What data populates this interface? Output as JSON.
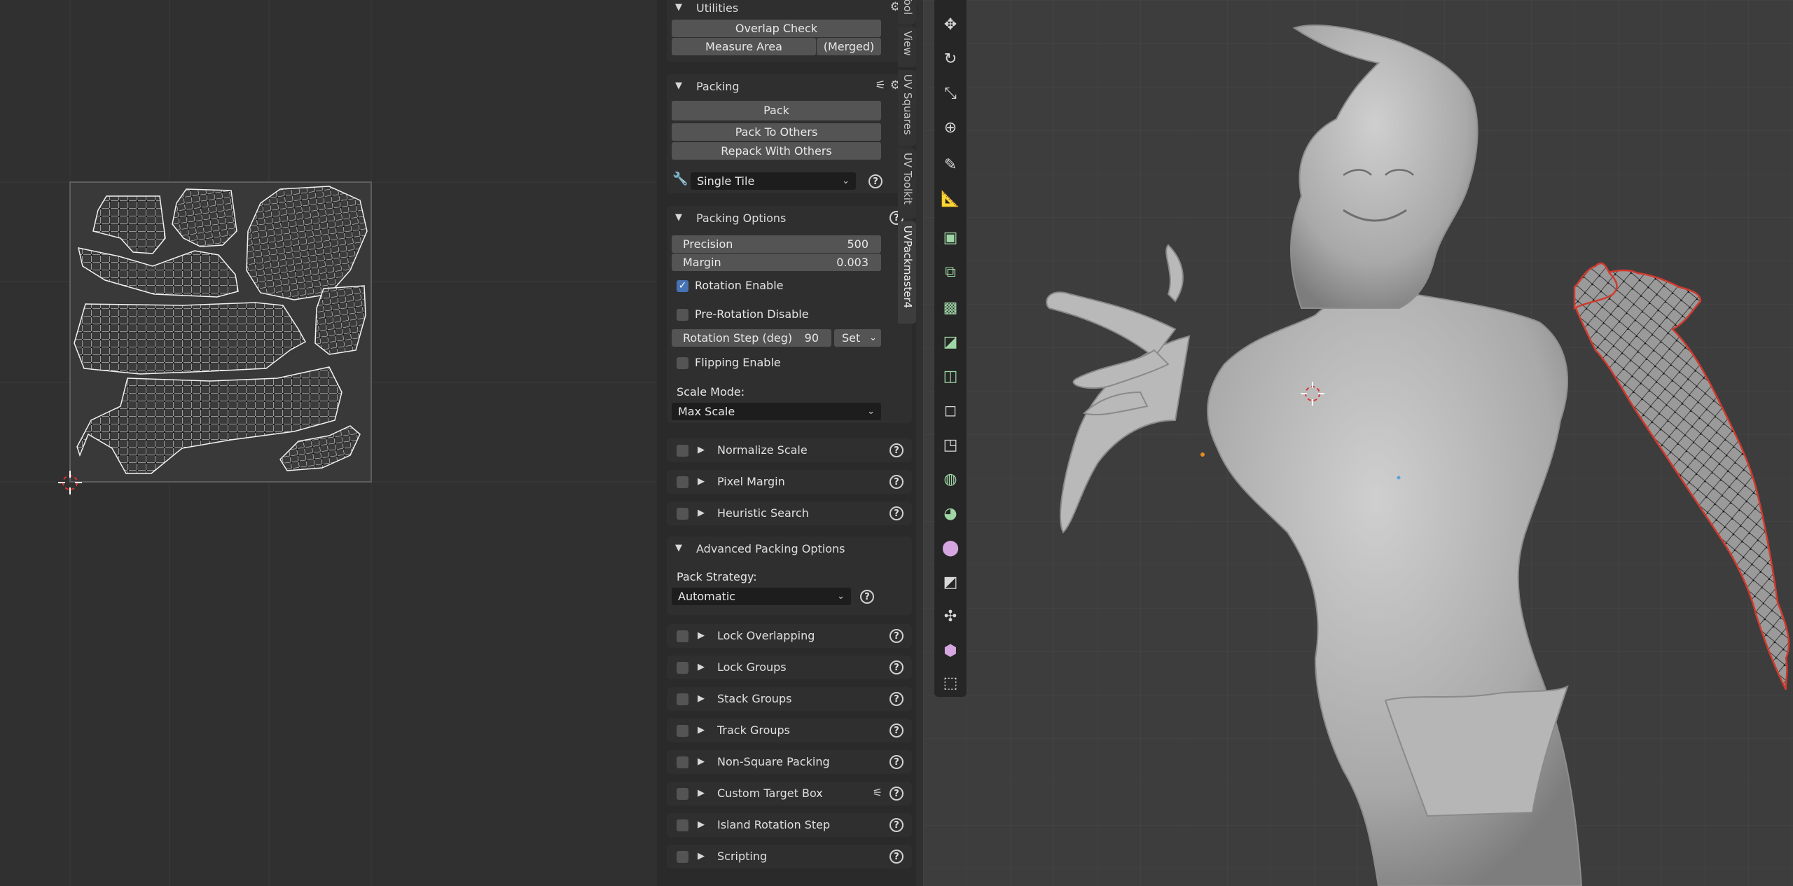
{
  "colors": {
    "uv_bg": "#303030",
    "panel_bg": "#2f2f2f",
    "button_bg": "#545454",
    "dropdown_bg": "#1d1d1d",
    "checkbox_on": "#4772b3",
    "viewport_bg": "#3d3d3d",
    "seam_red": "#d23a2e",
    "mesh_gray": "#bdbdbd"
  },
  "utilities": {
    "title": "Utilities",
    "overlap_check": "Overlap Check",
    "measure_area": "Measure Area",
    "merged": "(Merged)"
  },
  "packing": {
    "title": "Packing",
    "pack": "Pack",
    "pack_to_others": "Pack To Others",
    "repack_with_others": "Repack With Others",
    "tile_mode": "Single Tile"
  },
  "packing_options": {
    "title": "Packing Options",
    "precision_label": "Precision",
    "precision_value": "500",
    "margin_label": "Margin",
    "margin_value": "0.003",
    "rotation_enable": "Rotation Enable",
    "pre_rotation_disable": "Pre-Rotation Disable",
    "rotation_step_label": "Rotation Step (deg)",
    "rotation_step_value": "90",
    "set_label": "Set",
    "flipping_enable": "Flipping Enable",
    "scale_mode_label": "Scale Mode:",
    "scale_mode_value": "Max Scale"
  },
  "sub1": {
    "normalize_scale": "Normalize Scale",
    "pixel_margin": "Pixel Margin",
    "heuristic_search": "Heuristic Search"
  },
  "advanced": {
    "title": "Advanced Packing Options",
    "pack_strategy_label": "Pack Strategy:",
    "pack_strategy_value": "Automatic"
  },
  "sub2": {
    "lock_overlapping": "Lock Overlapping",
    "lock_groups": "Lock Groups",
    "stack_groups": "Stack Groups",
    "track_groups": "Track Groups",
    "non_square_packing": "Non-Square Packing",
    "custom_target_box": "Custom Target Box",
    "island_rotation_step": "Island Rotation Step",
    "scripting": "Scripting"
  },
  "tabs": {
    "tool": "Tool",
    "view": "View",
    "uv_squares": "UV Squares",
    "uv_toolkit": "UV Toolkit",
    "uvpackmaster": "UVPackmaster4"
  },
  "toolbar_icons": [
    "move-icon",
    "rotate-icon",
    "scale-icon",
    "transform-icon",
    "annotate-icon",
    "measure-icon",
    "add-cube-icon",
    "extrude-icon",
    "inset-icon",
    "bevel-icon",
    "loop-cut-icon",
    "knife-icon",
    "poly-build-icon",
    "spin-icon",
    "smooth-icon",
    "edge-slide-icon",
    "shrink-fatten-icon",
    "shear-icon",
    "rip-region-icon"
  ]
}
